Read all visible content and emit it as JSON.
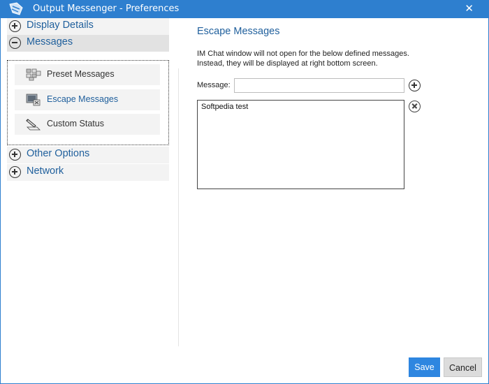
{
  "window": {
    "title": "Output Messenger - Preferences",
    "close_label": "✕"
  },
  "sidebar": {
    "categories": [
      {
        "label": "Display Details",
        "state": "collapsed"
      },
      {
        "label": "Messages",
        "state": "expanded"
      },
      {
        "label": "Other Options",
        "state": "collapsed"
      },
      {
        "label": "Network",
        "state": "collapsed"
      }
    ],
    "messages_items": [
      {
        "label": "Preset Messages",
        "icon": "grid-icon"
      },
      {
        "label": "Escape Messages",
        "icon": "image-icon",
        "selected": true
      },
      {
        "label": "Custom Status",
        "icon": "pencil-icon"
      }
    ]
  },
  "content": {
    "title": "Escape Messages",
    "description_line1": "IM Chat window will not open for the below defined messages.",
    "description_line2": "Instead, they will be displayed at right bottom screen.",
    "message_label": "Message:",
    "message_value": "",
    "messages": [
      "Softpedia test"
    ]
  },
  "footer": {
    "save_label": "Save",
    "cancel_label": "Cancel"
  },
  "colors": {
    "accent": "#2e7fcf",
    "link_text": "#1f5f9c",
    "save_button": "#2e86e0"
  }
}
